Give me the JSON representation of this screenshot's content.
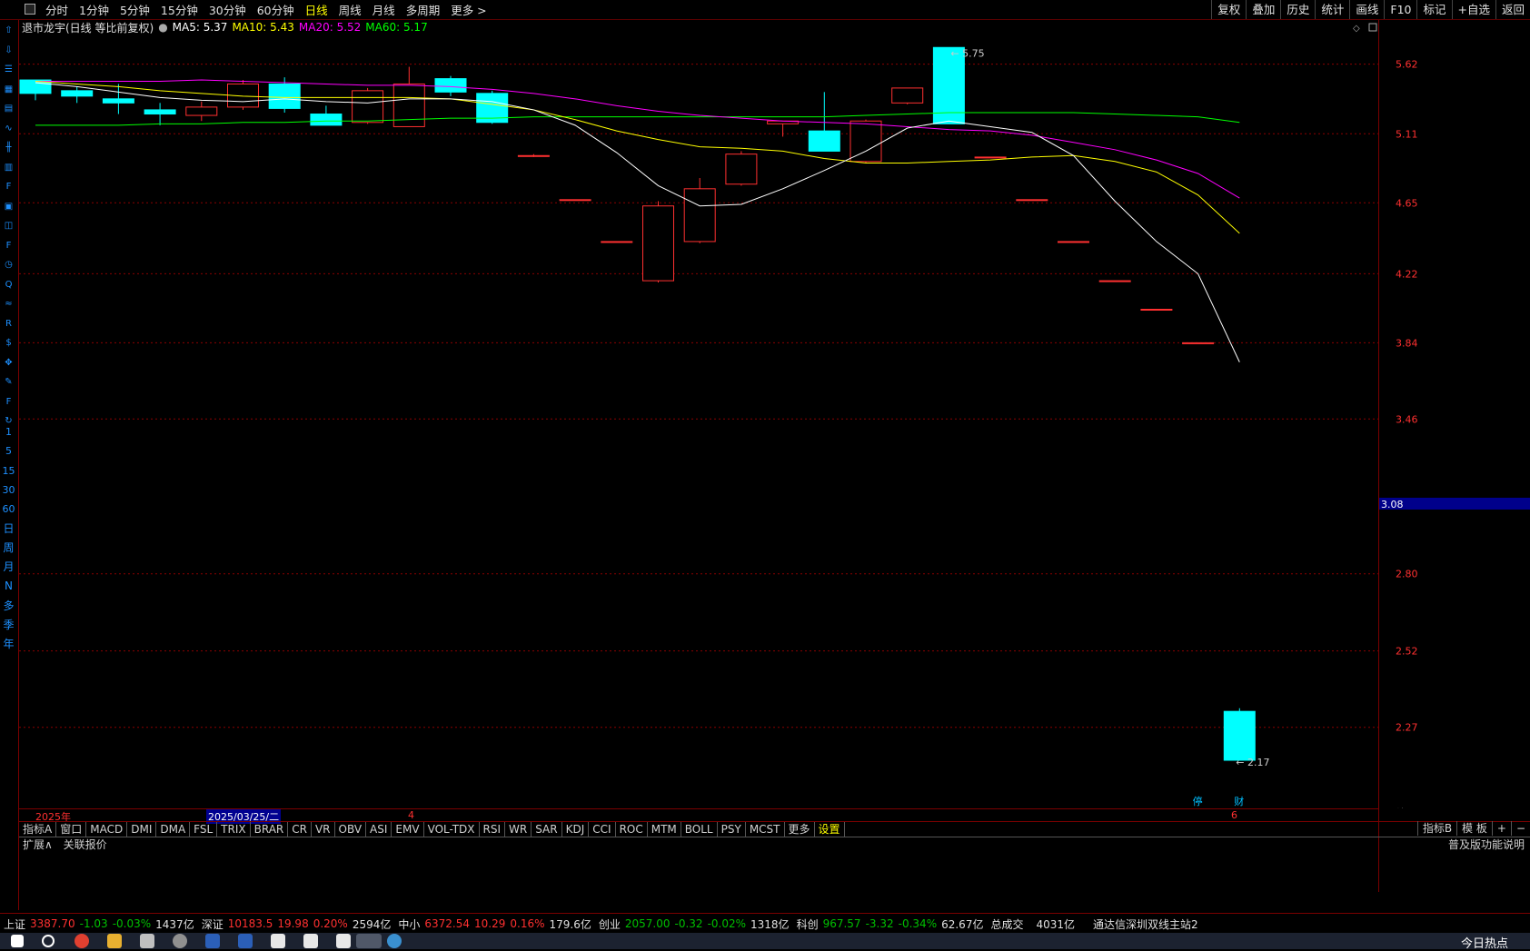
{
  "toolbar": {
    "periods": [
      "分时",
      "1分钟",
      "5分钟",
      "15分钟",
      "30分钟",
      "60分钟",
      "日线",
      "周线",
      "月线",
      "多周期",
      "更多 >"
    ],
    "active_period": "日线",
    "right_tools": [
      "复权",
      "叠加",
      "历史",
      "统计",
      "画线",
      "F10",
      "标记",
      "+自选",
      "返回"
    ]
  },
  "left_toolbar": [
    "1",
    "5",
    "15",
    "30",
    "60",
    "日",
    "周",
    "月",
    "N",
    "多",
    "季",
    "年"
  ],
  "left_toolbar_icons": [
    "arrow-up-icon",
    "arrow-down-icon",
    "list-icon",
    "grid-icon",
    "table-icon",
    "line-chart-icon",
    "kline-icon",
    "report-icon",
    "fin-icon",
    "f10-icon",
    "compare-icon",
    "fiz-icon",
    "clock-icon",
    "search-icon",
    "wave-icon",
    "rsi-icon",
    "money-icon",
    "move-icon",
    "pencil-icon",
    "fs-icon",
    "refresh-icon"
  ],
  "stock": {
    "title": "退市龙宇(日线 等比前复权)",
    "ma_labels": [
      {
        "text": "MA5: 5.37",
        "color": "#ffffff"
      },
      {
        "text": "MA10: 5.43",
        "color": "#ffff00"
      },
      {
        "text": "MA20: 5.52",
        "color": "#ff00ff"
      },
      {
        "text": "MA60: 5.17",
        "color": "#00ff00"
      }
    ]
  },
  "chart_data": {
    "type": "candlestick",
    "y_ticks": [
      5.62,
      5.11,
      4.65,
      4.22,
      3.84,
      3.46,
      2.8,
      2.52,
      2.27
    ],
    "current_price_label": "3.08",
    "high_annotation": "5.75",
    "low_annotation": "2.17",
    "period_label": "日线",
    "colors": {
      "up": "#ff3030",
      "down": "#00ffff",
      "ma5": "#ffffff",
      "ma10": "#ffff00",
      "ma20": "#ff00ff",
      "ma60": "#00ff00",
      "grid": "#8b0000"
    },
    "candles": [
      {
        "o": 5.5,
        "h": 5.5,
        "l": 5.35,
        "c": 5.4
      },
      {
        "o": 5.42,
        "h": 5.45,
        "l": 5.33,
        "c": 5.38
      },
      {
        "o": 5.36,
        "h": 5.47,
        "l": 5.25,
        "c": 5.33
      },
      {
        "o": 5.28,
        "h": 5.33,
        "l": 5.17,
        "c": 5.25
      },
      {
        "o": 5.24,
        "h": 5.34,
        "l": 5.2,
        "c": 5.3
      },
      {
        "o": 5.3,
        "h": 5.5,
        "l": 5.28,
        "c": 5.47
      },
      {
        "o": 5.47,
        "h": 5.52,
        "l": 5.26,
        "c": 5.29
      },
      {
        "o": 5.25,
        "h": 5.31,
        "l": 5.2,
        "c": 5.17
      },
      {
        "o": 5.19,
        "h": 5.44,
        "l": 5.18,
        "c": 5.42
      },
      {
        "o": 5.16,
        "h": 5.6,
        "l": 5.16,
        "c": 5.47
      },
      {
        "o": 5.51,
        "h": 5.53,
        "l": 5.38,
        "c": 5.41
      },
      {
        "o": 5.4,
        "h": 5.42,
        "l": 5.18,
        "c": 5.19
      },
      {
        "o": 4.96,
        "h": 4.97,
        "l": 4.95,
        "c": 4.96
      },
      {
        "o": 4.67,
        "h": 4.67,
        "l": 4.67,
        "c": 4.67
      },
      {
        "o": 4.41,
        "h": 4.41,
        "l": 4.41,
        "c": 4.41
      },
      {
        "o": 4.18,
        "h": 4.66,
        "l": 4.17,
        "c": 4.63
      },
      {
        "o": 4.41,
        "h": 4.81,
        "l": 4.4,
        "c": 4.74
      },
      {
        "o": 4.77,
        "h": 4.99,
        "l": 4.76,
        "c": 4.97
      },
      {
        "o": 5.18,
        "h": 5.2,
        "l": 5.09,
        "c": 5.2
      },
      {
        "o": 5.13,
        "h": 5.41,
        "l": 5.13,
        "c": 4.99
      },
      {
        "o": 4.92,
        "h": 5.21,
        "l": 4.91,
        "c": 5.2
      },
      {
        "o": 5.33,
        "h": 5.44,
        "l": 5.32,
        "c": 5.44
      },
      {
        "o": 5.75,
        "h": 5.75,
        "l": 5.18,
        "c": 5.18
      },
      {
        "o": 4.95,
        "h": 4.95,
        "l": 4.95,
        "c": 4.95
      },
      {
        "o": 4.67,
        "h": 4.67,
        "l": 4.67,
        "c": 4.67
      },
      {
        "o": 4.41,
        "h": 4.41,
        "l": 4.41,
        "c": 4.41
      },
      {
        "o": 4.18,
        "h": 4.18,
        "l": 4.18,
        "c": 4.18
      },
      {
        "o": 4.02,
        "h": 4.02,
        "l": 4.02,
        "c": 4.02
      },
      {
        "o": 3.84,
        "h": 3.84,
        "l": 3.84,
        "c": 3.84
      },
      {
        "o": 2.32,
        "h": 2.33,
        "l": 2.17,
        "c": 2.17
      }
    ],
    "ma5": [
      5.48,
      5.45,
      5.41,
      5.37,
      5.35,
      5.34,
      5.36,
      5.34,
      5.33,
      5.36,
      5.36,
      5.34,
      5.28,
      5.17,
      4.98,
      4.76,
      4.63,
      4.64,
      4.74,
      4.86,
      4.99,
      5.15,
      5.2,
      5.16,
      5.12,
      4.96,
      4.66,
      4.41,
      4.22,
      3.74
    ],
    "ma10": [
      5.49,
      5.47,
      5.45,
      5.42,
      5.4,
      5.38,
      5.37,
      5.37,
      5.37,
      5.37,
      5.36,
      5.32,
      5.28,
      5.21,
      5.13,
      5.07,
      5.02,
      5.01,
      4.99,
      4.94,
      4.91,
      4.91,
      4.92,
      4.93,
      4.95,
      4.96,
      4.92,
      4.85,
      4.7,
      4.46
    ],
    "ma20": [
      5.49,
      5.49,
      5.49,
      5.49,
      5.5,
      5.49,
      5.48,
      5.47,
      5.46,
      5.46,
      5.45,
      5.43,
      5.4,
      5.36,
      5.31,
      5.27,
      5.24,
      5.22,
      5.2,
      5.19,
      5.18,
      5.16,
      5.14,
      5.13,
      5.1,
      5.05,
      5.0,
      4.93,
      4.84,
      4.68
    ],
    "ma60": [
      5.17,
      5.17,
      5.17,
      5.18,
      5.18,
      5.19,
      5.19,
      5.2,
      5.2,
      5.21,
      5.22,
      5.22,
      5.23,
      5.23,
      5.23,
      5.23,
      5.23,
      5.23,
      5.23,
      5.23,
      5.24,
      5.25,
      5.26,
      5.26,
      5.26,
      5.26,
      5.25,
      5.24,
      5.23,
      5.19
    ]
  },
  "xaxis": {
    "year_label": "2025年",
    "selected_date": "2025/03/25/二",
    "month4": "4",
    "month6": "6",
    "events": [
      "停",
      "财"
    ]
  },
  "indicator_tabs": [
    "指标A",
    "窗口",
    "MACD",
    "DMI",
    "DMA",
    "FSL",
    "TRIX",
    "BRAR",
    "CR",
    "VR",
    "OBV",
    "ASI",
    "EMV",
    "VOL-TDX",
    "RSI",
    "WR",
    "SAR",
    "KDJ",
    "CCI",
    "ROC",
    "MTM",
    "BOLL",
    "PSY",
    "MCST",
    "更多",
    "设置"
  ],
  "indicator_right": [
    "指标B",
    "模 板",
    "+",
    "−"
  ],
  "expand": {
    "left1": "扩展∧",
    "left2": "关联报价",
    "right": "普及版功能说明"
  },
  "status": {
    "sh": {
      "name": "上证",
      "price": "3387.70",
      "chg": "-1.03",
      "pct": "-0.03%",
      "amt": "1437亿"
    },
    "sz": {
      "name": "深证",
      "price": "10183.5",
      "chg": "19.98",
      "pct": "0.20%",
      "amt": "2594亿"
    },
    "zx": {
      "name": "中小",
      "price": "6372.54",
      "chg": "10.29",
      "pct": "0.16%",
      "amt": "179.6亿"
    },
    "cy": {
      "name": "创业",
      "price": "2057.00",
      "chg": "-0.32",
      "pct": "-0.02%",
      "amt": "1318亿"
    },
    "kc": {
      "name": "科创",
      "price": "967.57",
      "chg": "-3.32",
      "pct": "-0.34%",
      "amt": "62.67亿"
    },
    "total_label": "总成交",
    "total_amt": "4031亿",
    "server": "通达信深圳双线主站2"
  },
  "taskbar": {
    "news_label": "今日热点"
  }
}
